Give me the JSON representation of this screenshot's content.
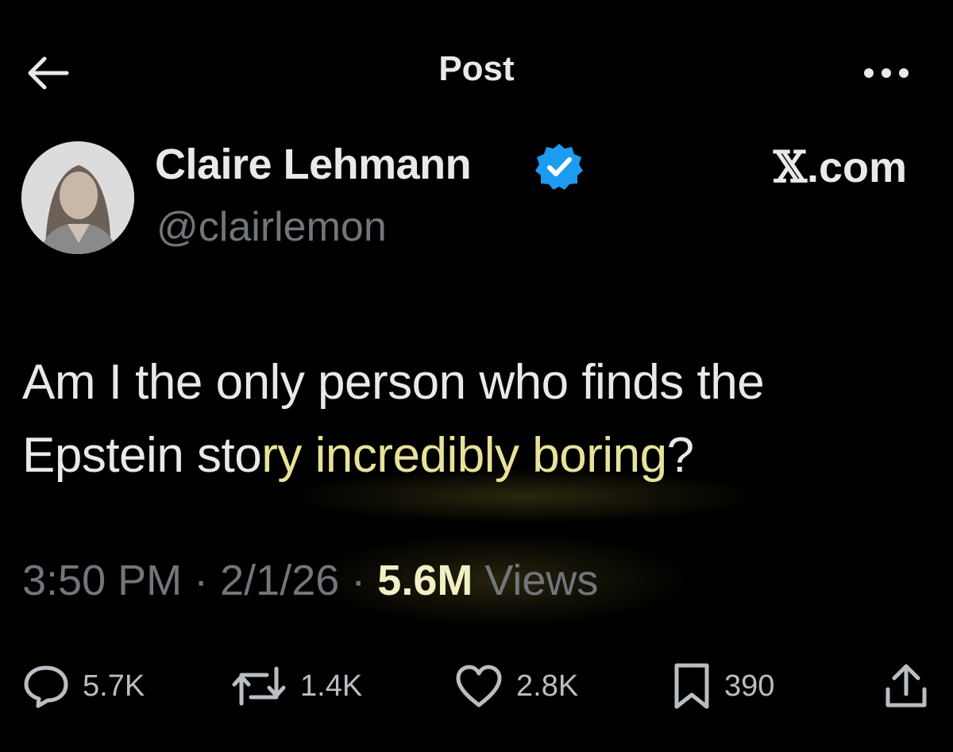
{
  "header": {
    "title": "Post",
    "back_icon": "arrow-left-icon",
    "more_icon": "more-horizontal-icon"
  },
  "author": {
    "name": "Claire Lehmann",
    "handle": "@clairlemon",
    "verified_color": "#1d9bf0"
  },
  "source": {
    "logo": "𝕏",
    "suffix": ".com"
  },
  "tweet": {
    "line1": "Am I the only person who finds the",
    "line2_plain": "Epstein sto",
    "line2_highlight": "ry incredibly boring",
    "line2_end": "?"
  },
  "meta": {
    "time": "3:50 PM",
    "date": "2/1/26",
    "views_count": "5.6M",
    "views_label": "Views",
    "separator": "·"
  },
  "actions": {
    "replies": "5.7K",
    "reposts": "1.4K",
    "likes": "2.8K",
    "bookmarks": "390"
  },
  "colors": {
    "background": "#000000",
    "text": "#e7e9ea",
    "muted": "#71767b",
    "highlight": "#e8e29a"
  }
}
